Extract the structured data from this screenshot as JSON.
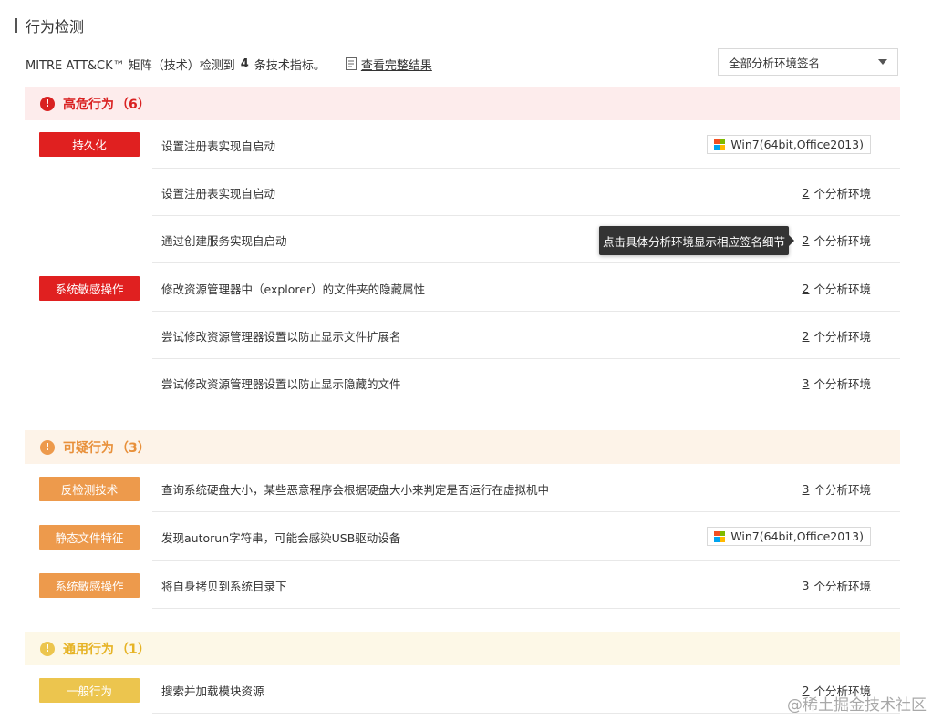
{
  "page_title": "行为检测",
  "summary": {
    "prefix": "MITRE ATT&CK™ 矩阵（技术）检测到",
    "count": "4",
    "suffix": "条技术指标。",
    "full_results_link": "查看完整结果"
  },
  "env_select": {
    "selected": "全部分析环境签名"
  },
  "env_unit": "个分析环境",
  "win_env_label": "Win7(64bit,Office2013)",
  "colors": {
    "high_head_bg": "#fdecec",
    "high_text": "#d92121",
    "high_tag": "#e02020",
    "sus_head_bg": "#fdf3e8",
    "sus_text": "#e8903a",
    "sus_tag": "#ed9a4c",
    "gen_head_bg": "#fdf8e7",
    "gen_text": "#e6b325",
    "gen_tag": "#ecc54e"
  },
  "sections": {
    "high": {
      "title": "高危行为",
      "count": "（6）",
      "tags": [
        "持久化",
        "系统敏感操作"
      ],
      "rows": [
        {
          "text": "设置注册表实现自启动",
          "env": "Win7(64bit,Office2013)"
        },
        {
          "text": "设置注册表实现自启动",
          "num": "2"
        },
        {
          "text": "通过创建服务实现自启动",
          "num": "2"
        },
        {
          "text": "修改资源管理器中（explorer）的文件夹的隐藏属性",
          "num": "2"
        },
        {
          "text": "尝试修改资源管理器设置以防止显示文件扩展名",
          "num": "2"
        },
        {
          "text": "尝试修改资源管理器设置以防止显示隐藏的文件",
          "num": "3"
        }
      ]
    },
    "suspicious": {
      "title": "可疑行为",
      "count": "（3）",
      "tags": [
        "反检测技术",
        "静态文件特征",
        "系统敏感操作"
      ],
      "rows": [
        {
          "text": "查询系统硬盘大小，某些恶意程序会根据硬盘大小来判定是否运行在虚拟机中",
          "num": "3"
        },
        {
          "text": "发现autorun字符串，可能会感染USB驱动设备",
          "env": "Win7(64bit,Office2013)"
        },
        {
          "text": "将自身拷贝到系统目录下",
          "num": "3"
        }
      ]
    },
    "general": {
      "title": "通用行为",
      "count": "（1）",
      "tags": [
        "一般行为"
      ],
      "rows": [
        {
          "text": "搜索并加载模块资源",
          "num": "2"
        }
      ]
    }
  },
  "tooltip": "点击具体分析环境显示相应签名细节",
  "watermark": "@稀土掘金技术社区"
}
